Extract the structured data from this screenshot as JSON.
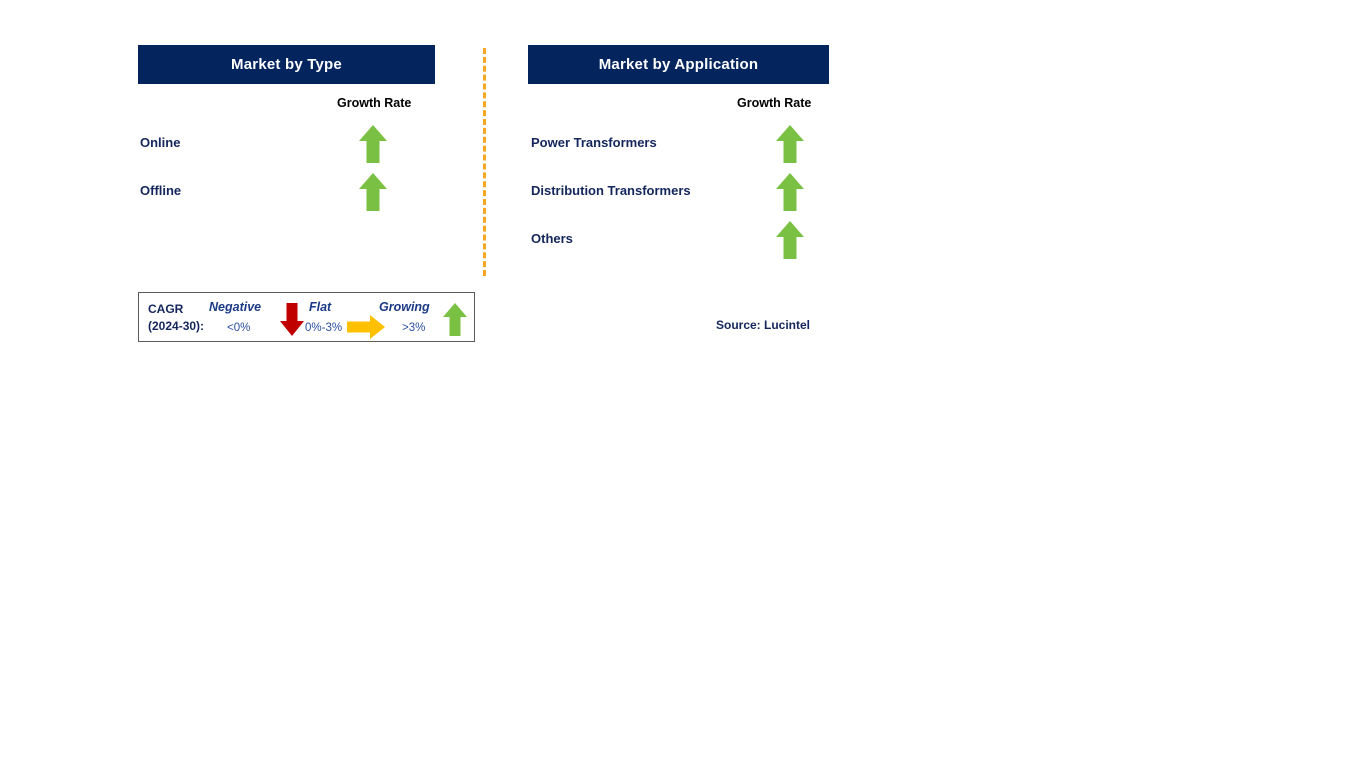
{
  "panels": [
    {
      "id": "market-by-type",
      "title": "Market by Type",
      "column_header": "Growth Rate",
      "rows": [
        {
          "label": "Online",
          "growth": "up",
          "growth_color": "#7ac143"
        },
        {
          "label": "Offline",
          "growth": "up",
          "growth_color": "#7ac143"
        }
      ]
    },
    {
      "id": "market-by-application",
      "title": "Market by Application",
      "column_header": "Growth Rate",
      "rows": [
        {
          "label": "Power Transformers",
          "growth": "up",
          "growth_color": "#7ac143"
        },
        {
          "label": "Distribution Transformers",
          "growth": "up",
          "growth_color": "#7ac143"
        },
        {
          "label": "Others",
          "growth": "up",
          "growth_color": "#7ac143"
        }
      ]
    }
  ],
  "legend": {
    "title_line1": "CAGR",
    "title_line2": "(2024-30):",
    "items": [
      {
        "term": "Negative",
        "range": "<0%",
        "icon": "arrow-down-icon",
        "color": "#c00000"
      },
      {
        "term": "Flat",
        "range": "0%-3%",
        "icon": "arrow-right-icon",
        "color": "#ffc000"
      },
      {
        "term": "Growing",
        "range": ">3%",
        "icon": "arrow-up-icon",
        "color": "#7ac143"
      }
    ]
  },
  "source": "Source: Lucintel",
  "colors": {
    "header_navy": "#04245e",
    "label_navy": "#14265c",
    "green": "#7ac143",
    "red": "#c00000",
    "yellow": "#ffc000",
    "divider_orange": "#f5a623"
  }
}
